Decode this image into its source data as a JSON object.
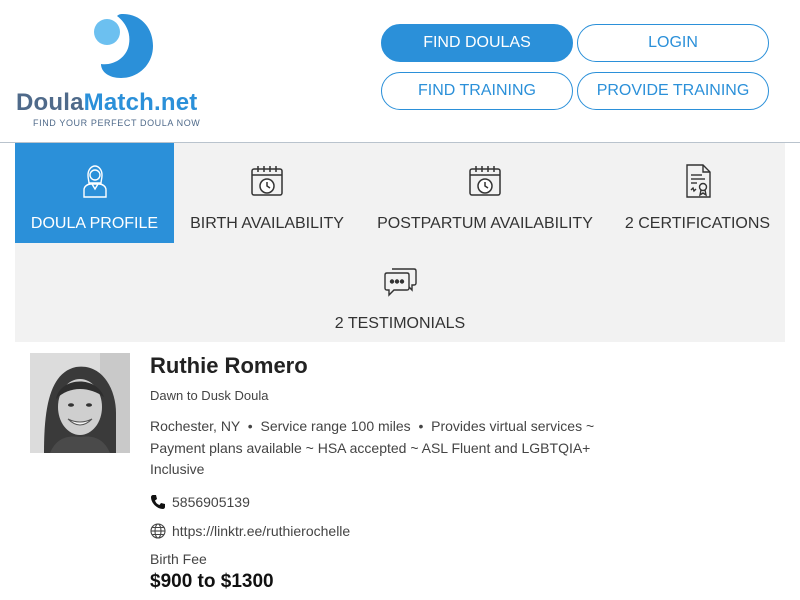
{
  "brand": {
    "logo_left": "Doula",
    "logo_right": "Match.net",
    "tagline": "FIND YOUR PERFECT DOULA NOW",
    "color_primary": "#2b90d9",
    "color_dark": "#4f6a8a"
  },
  "nav": {
    "find_doulas": "FIND DOULAS",
    "login": "LOGIN",
    "find_training": "FIND TRAINING",
    "provide_training": "PROVIDE TRAINING"
  },
  "tabs": [
    {
      "label": "DOULA PROFILE",
      "icon": "doula-person-icon",
      "active": true
    },
    {
      "label": "BIRTH AVAILABILITY",
      "icon": "calendar-clock-icon",
      "active": false
    },
    {
      "label": "POSTPARTUM AVAILABILITY",
      "icon": "calendar-clock-icon",
      "active": false
    },
    {
      "label": "2 CERTIFICATIONS",
      "icon": "certificate-icon",
      "active": false
    },
    {
      "label": "2 TESTIMONIALS",
      "icon": "chat-bubbles-icon",
      "active": false
    }
  ],
  "profile": {
    "name": "Ruthie Romero",
    "title": "Dawn to Dusk Doula",
    "location": "Rochester, NY",
    "service_range": "Service range 100 miles",
    "services_line": "Provides virtual services ~",
    "services_line2": "Payment plans available ~ HSA accepted ~ ASL Fluent and LGBTQIA+",
    "services_line3": "Inclusive",
    "phone": "5856905139",
    "website": "https://linktr.ee/ruthierochelle",
    "fee_label": "Birth Fee",
    "fee_value": "$900 to $1300"
  }
}
